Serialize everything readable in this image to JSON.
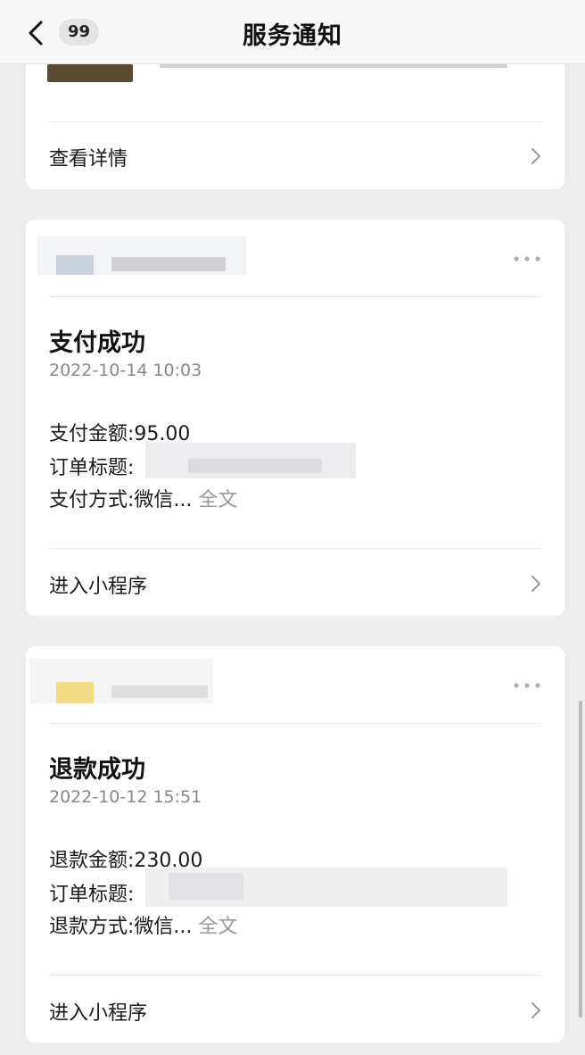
{
  "header": {
    "title": "服务通知",
    "badge": "99"
  },
  "card0": {
    "action": "查看详情"
  },
  "cards": [
    {
      "title": "支付成功",
      "time": "2022-10-14 10:03",
      "lines": [
        {
          "label": "支付金额:",
          "value": "95.00"
        },
        {
          "label": "订单标题:",
          "value": ""
        },
        {
          "label": "支付方式:",
          "value": "微信...",
          "more": "全文"
        }
      ],
      "action": "进入小程序"
    },
    {
      "title": "退款成功",
      "time": "2022-10-12 15:51",
      "lines": [
        {
          "label": "退款金额:",
          "value": "230.00"
        },
        {
          "label": "订单标题:",
          "value": ""
        },
        {
          "label": "退款方式:",
          "value": "微信...",
          "more": "全文"
        }
      ],
      "action": "进入小程序"
    }
  ],
  "icons": [
    "back-icon",
    "more-icon",
    "chevron-right-icon"
  ]
}
